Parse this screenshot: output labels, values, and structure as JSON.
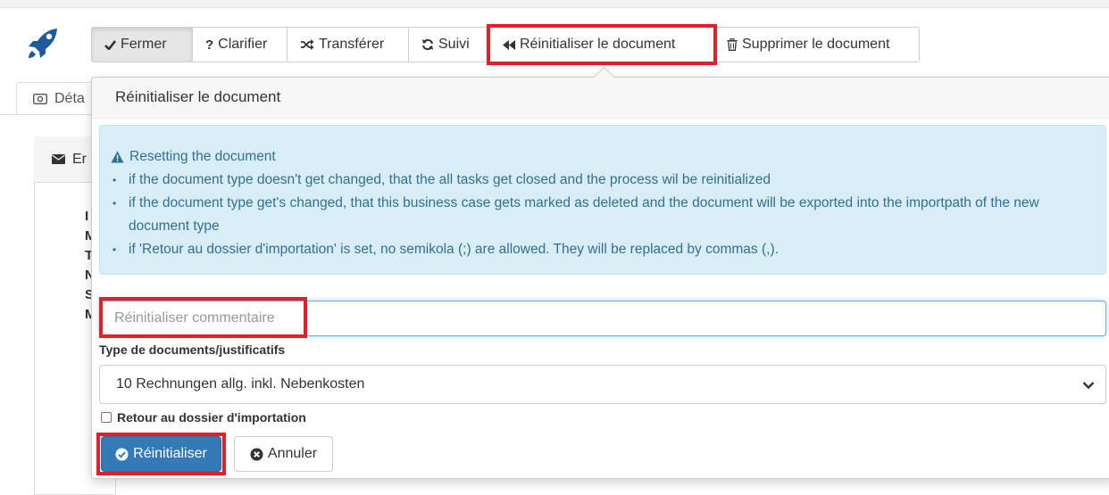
{
  "toolbar": {
    "buttons": [
      {
        "label": "Fermer",
        "icon": "check-icon"
      },
      {
        "label": "Clarifier",
        "icon": "question-icon"
      },
      {
        "label": "Transférer",
        "icon": "shuffle-icon"
      },
      {
        "label": "Suivi",
        "icon": "refresh-icon"
      },
      {
        "label": "Réinitialiser le document",
        "icon": "fast-backward-icon"
      },
      {
        "label": "Supprimer le document",
        "icon": "trash-icon"
      }
    ]
  },
  "background": {
    "tab_label": "Déta",
    "panel_label": "Er",
    "letters": [
      "I",
      "M",
      "T",
      "N",
      "S",
      "M"
    ]
  },
  "popover": {
    "title": "Réinitialiser le document",
    "alert": {
      "title": "Resetting the document",
      "items": [
        "if the document type doesn't get changed, that the all tasks get closed and the process wil be reinitialized",
        "if the document type get's changed, that this business case gets marked as deleted and the document will be exported into the importpath of the new document type",
        "if 'Retour au dossier d'importation' is set, no semikola (;) are allowed. They will be replaced by commas (,)."
      ]
    },
    "comment_placeholder": "Réinitialiser commentaire",
    "comment_value": "",
    "doc_type_label": "Type de documents/justificatifs",
    "doc_type_value": "10 Rechnungen allg. inkl. Nebenkosten",
    "checkbox_label": "Retour au dossier d'importation",
    "checkbox_checked": false,
    "submit_label": "Réinitialiser",
    "cancel_label": "Annuler"
  },
  "colors": {
    "highlight": "#e3202a",
    "primary": "#337ab7",
    "alert_bg": "#d9edf7",
    "alert_text": "#31708f",
    "logo": "#1f5b99"
  }
}
